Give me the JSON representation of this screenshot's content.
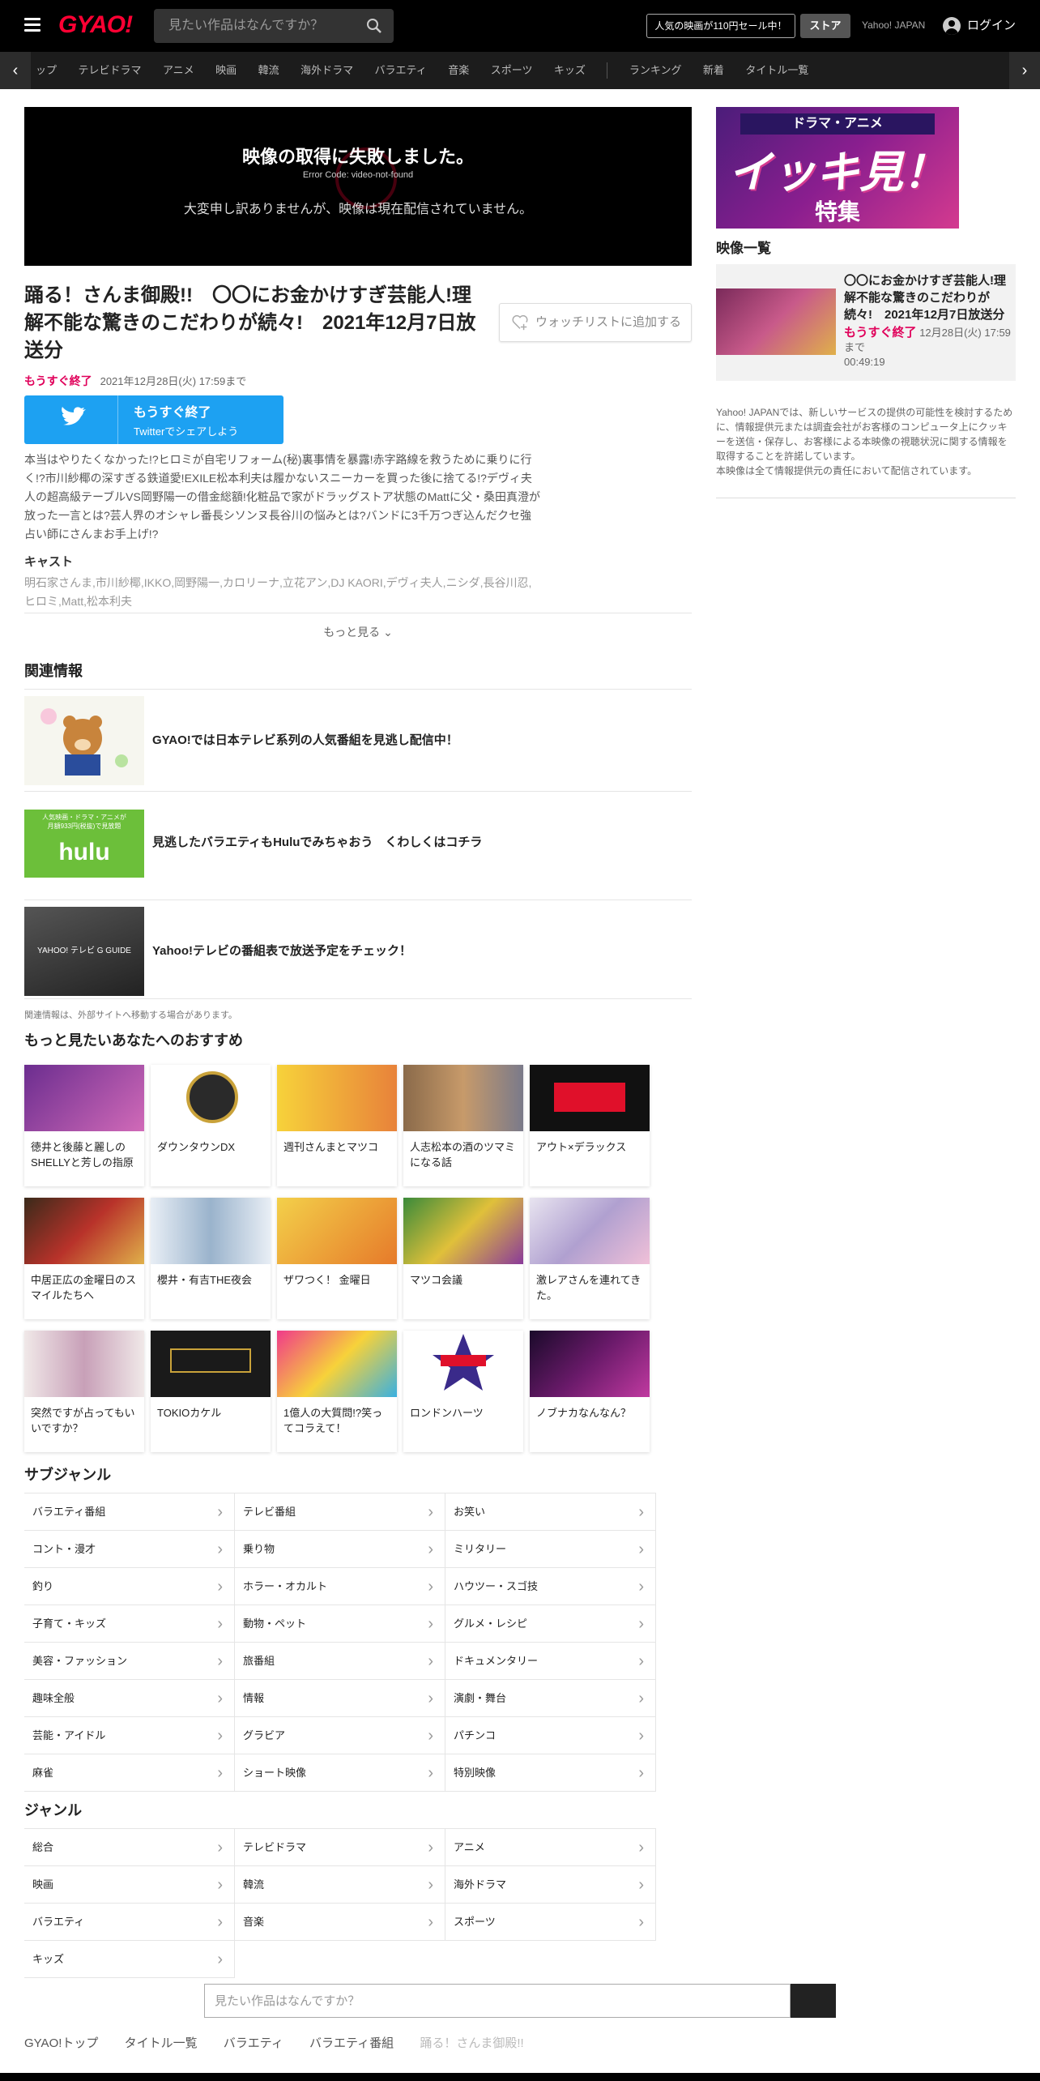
{
  "header": {
    "logo": "GYAO!",
    "search_placeholder": "見たい作品はなんですか？",
    "promo": "人気の映画が110円セール中！",
    "store": "ストア",
    "yahoo": "Yahoo! JAPAN",
    "login": "ログイン"
  },
  "nav": {
    "items": [
      "ップ",
      "テレビドラマ",
      "アニメ",
      "映画",
      "韓流",
      "海外ドラマ",
      "バラエティ",
      "音楽",
      "スポーツ",
      "キッズ"
    ],
    "items2": [
      "ランキング",
      "新着",
      "タイトル一覧"
    ]
  },
  "player": {
    "error_title": "映像の取得に失敗しました。",
    "error_code": "Error Code: video-not-found",
    "error_message": "大変申し訳ありませんが、映像は現在配信されていません。"
  },
  "video": {
    "title": "踊る！さんま御殿!!　〇〇にお金かけすぎ芸能人!理解不能な驚きのこだわりが続々!　2021年12月7日放送分",
    "watchlist": "ウォッチリストに追加する",
    "soon": "もうすぐ終了",
    "expire": "2021年12月28日(火) 17:59まで",
    "twitter_l1": "もうすぐ終了",
    "twitter_l2": "Twitterでシェアしよう",
    "description": "本当はやりたくなかった!?ヒロミが自宅リフォーム(秘)裏事情を暴露!赤字路線を救うために乗りに行く!?市川紗椰の深すぎる鉄道愛!EXILE松本利夫は履かないスニーカーを買った後に捨てる!?デヴィ夫人の超高級テーブルVS岡野陽一の借金総額!化粧品で家がドラッグストア状態のMattに父・桑田真澄が放った一言とは?芸人界のオシャレ番長シソンヌ長谷川の悩みとは?バンドに3千万つぎ込んだクセ強占い師にさんまお手上げ!?",
    "cast_heading": "キャスト",
    "cast": "明石家さんま,市川紗椰,IKKO,岡野陽一,カロリーナ,立花アン,DJ KAORI,デヴィ夫人,ニシダ,長谷川忍,ヒロミ,Matt,松本利夫",
    "more": "もっと見る"
  },
  "related": {
    "heading": "関連情報",
    "items": [
      {
        "text": "GYAO!では日本テレビ系列の人気番組を見逃し配信中！"
      },
      {
        "text": "見逃したバラエティもHuluでみちゃおう　くわしくはコチラ",
        "thumb_top": "人気映画・ドラマ・アニメが",
        "thumb_mid": "月額933円(税抜)で見放題",
        "thumb_logo": "hulu"
      },
      {
        "text": "Yahoo!テレビの番組表で放送予定をチェック！",
        "thumb_logo": "YAHOO! テレビ G GUIDE"
      }
    ],
    "note": "関連情報は、外部サイトへ移動する場合があります。"
  },
  "recommend": {
    "heading": "もっと見たいあなたへのおすすめ",
    "items": [
      {
        "title": "徳井と後藤と麗しのSHELLYと芳しの指原"
      },
      {
        "title": "ダウンタウンDX"
      },
      {
        "title": "週刊さんまとマツコ"
      },
      {
        "title": "人志松本の酒のツマミになる話"
      },
      {
        "title": "アウト×デラックス"
      },
      {
        "title": "中居正広の金曜日のスマイルたちへ"
      },
      {
        "title": "櫻井・有吉THE夜会"
      },
      {
        "title": "ザワつく！ 金曜日"
      },
      {
        "title": "マツコ会議"
      },
      {
        "title": "激レアさんを連れてきた。"
      },
      {
        "title": "突然ですが占ってもいいですか？"
      },
      {
        "title": "TOKIOカケル"
      },
      {
        "title": "1億人の大質問!?笑ってコラえて！"
      },
      {
        "title": "ロンドンハーツ"
      },
      {
        "title": "ノブナカなんなん？"
      }
    ]
  },
  "subgenre": {
    "heading": "サブジャンル",
    "items": [
      "バラエティ番組",
      "テレビ番組",
      "お笑い",
      "コント・漫才",
      "乗り物",
      "ミリタリー",
      "釣り",
      "ホラー・オカルト",
      "ハウツー・スゴ技",
      "子育て・キッズ",
      "動物・ペット",
      "グルメ・レシピ",
      "美容・ファッション",
      "旅番組",
      "ドキュメンタリー",
      "趣味全般",
      "情報",
      "演劇・舞台",
      "芸能・アイドル",
      "グラビア",
      "パチンコ",
      "麻雀",
      "ショート映像",
      "特別映像"
    ]
  },
  "genre": {
    "heading": "ジャンル",
    "items": [
      "総合",
      "テレビドラマ",
      "アニメ",
      "映画",
      "韓流",
      "海外ドラマ",
      "バラエティ",
      "音楽",
      "スポーツ",
      "キッズ"
    ]
  },
  "bottom_search_placeholder": "見たい作品はなんですか？",
  "breadcrumbs": [
    "GYAO!トップ",
    "タイトル一覧",
    "バラエティ",
    "バラエティ番組",
    "踊る！さんま御殿!!"
  ],
  "sidebar": {
    "banner_top": "ドラマ・アニメ",
    "banner_main": "イッキ見！",
    "banner_sub": "特集",
    "list_heading": "映像一覧",
    "video_title": "〇〇にお金かけすぎ芸能人!理解不能な驚きのこだわりが続々!　2021年12月7日放送分",
    "video_soon": "もうすぐ終了",
    "video_expire": "12月28日(火) 17:59まで",
    "video_duration": "00:49:19",
    "note": "Yahoo! JAPANでは、新しいサービスの提供の可能性を検討するために、情報提供元または調査会社がお客様のコンピュータ上にクッキーを送信・保存し、お客様による本映像の視聴状況に関する情報を取得することを許諾しています。\n本映像は全て情報提供元の責任において配信されています。"
  }
}
